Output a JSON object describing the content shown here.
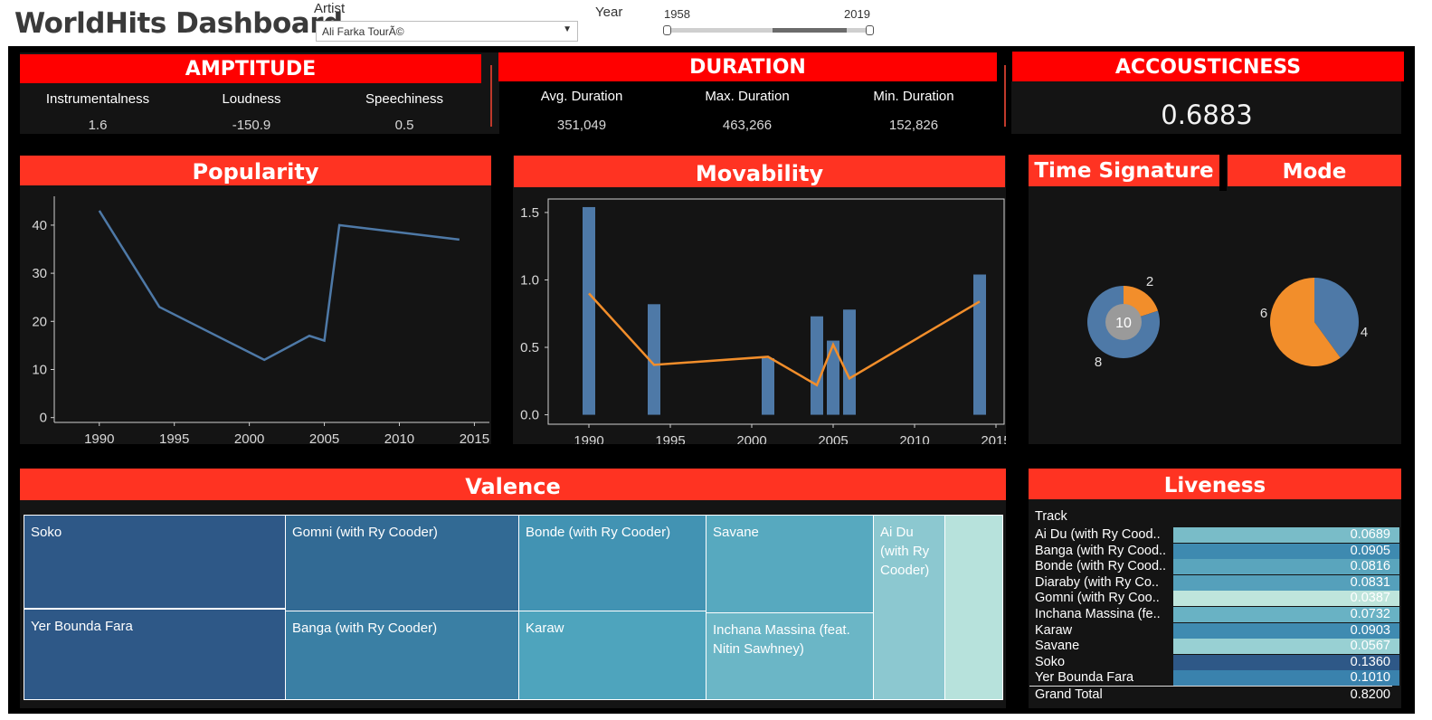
{
  "header": {
    "title": "WorldHits Dashboard",
    "artist_label": "Artist",
    "artist_value": "Ali Farka TourÃ©",
    "year_label": "Year",
    "year_min": "1958",
    "year_max": "2019"
  },
  "amptitude": {
    "title": "AMPTITUDE",
    "items": [
      {
        "label": "Instrumentalness",
        "value": "1.6"
      },
      {
        "label": "Loudness",
        "value": "-150.9"
      },
      {
        "label": "Speechiness",
        "value": "0.5"
      }
    ]
  },
  "duration": {
    "title": "DURATION",
    "items": [
      {
        "label": "Avg. Duration",
        "value": "351,049"
      },
      {
        "label": "Max. Duration",
        "value": "463,266"
      },
      {
        "label": "Min. Duration",
        "value": "152,826"
      }
    ]
  },
  "acousticness": {
    "title": "ACCOUSTICNESS",
    "value": "0.6883"
  },
  "popularity": {
    "title": "Popularity"
  },
  "movability": {
    "title": "Movability"
  },
  "time_signature": {
    "title": "Time Signature"
  },
  "mode": {
    "title": "Mode"
  },
  "valence": {
    "title": "Valence",
    "cells": [
      "Soko",
      "Yer Bounda Fara",
      "Gomni (with Ry Cooder)",
      "Banga (with Ry Cooder)",
      "Bonde (with Ry Cooder)",
      "Karaw",
      "Savane",
      "Inchana Massina (feat. Nitin Sawhney)",
      "Ai Du (with Ry Cooder)",
      ""
    ]
  },
  "liveness": {
    "title": "Liveness",
    "column_header": "Track",
    "rows": [
      {
        "track": "Ai Du (with Ry Cood..",
        "value": "0.0689"
      },
      {
        "track": "Banga (with Ry Cood..",
        "value": "0.0905"
      },
      {
        "track": "Bonde (with Ry Cood..",
        "value": "0.0816"
      },
      {
        "track": "Diaraby (with Ry Co..",
        "value": "0.0831"
      },
      {
        "track": "Gomni (with Ry Coo..",
        "value": "0.0387"
      },
      {
        "track": "Inchana Massina (fe..",
        "value": "0.0732"
      },
      {
        "track": "Karaw",
        "value": "0.0903"
      },
      {
        "track": "Savane",
        "value": "0.0567"
      },
      {
        "track": "Soko",
        "value": "0.1360"
      },
      {
        "track": "Yer Bounda Fara",
        "value": "0.1010"
      }
    ],
    "grand_total_label": "Grand Total",
    "grand_total_value": "0.8200"
  },
  "colors": {
    "blue": "#4e79a7",
    "orange": "#f28e2b",
    "red": "#ff0000"
  },
  "chart_data": [
    {
      "type": "line",
      "title": "Popularity",
      "x": [
        1990,
        1994,
        2001,
        2004,
        2005,
        2006,
        2014
      ],
      "y": [
        43,
        23,
        12,
        17,
        16,
        40,
        37
      ],
      "xlim": [
        1987,
        2016
      ],
      "ylim": [
        -1,
        46
      ],
      "xticks": [
        1990,
        1995,
        2000,
        2005,
        2010,
        2015
      ],
      "yticks": [
        0,
        10,
        20,
        30,
        40
      ]
    },
    {
      "type": "bar",
      "title": "Movability",
      "bars": {
        "x": [
          1990,
          1994,
          2001,
          2004,
          2005,
          2006,
          2014
        ],
        "values": [
          1.54,
          0.82,
          0.42,
          0.73,
          0.55,
          0.78,
          1.04
        ]
      },
      "line": {
        "x": [
          1990,
          1994,
          2001,
          2004,
          2005,
          2006,
          2014
        ],
        "values": [
          0.9,
          0.37,
          0.43,
          0.22,
          0.52,
          0.27,
          0.84
        ]
      },
      "xlim": [
        1987.5,
        2015.5
      ],
      "ylim": [
        -0.07,
        1.6
      ],
      "xticks": [
        1990,
        1995,
        2000,
        2005,
        2010,
        2015
      ],
      "yticks": [
        0.0,
        0.5,
        1.0,
        1.5
      ],
      "ytick_labels": [
        "0.0",
        "0.5",
        "1.0",
        "1.5"
      ]
    },
    {
      "type": "pie",
      "title": "Time Signature",
      "center_label": "10",
      "slices": [
        {
          "label": "2",
          "value": 2,
          "color": "#f28e2b"
        },
        {
          "label": "8",
          "value": 8,
          "color": "#4e79a7"
        }
      ]
    },
    {
      "type": "pie",
      "title": "Mode",
      "slices": [
        {
          "label": "4",
          "value": 4,
          "color": "#4e79a7"
        },
        {
          "label": "6",
          "value": 6,
          "color": "#f28e2b"
        }
      ]
    }
  ]
}
